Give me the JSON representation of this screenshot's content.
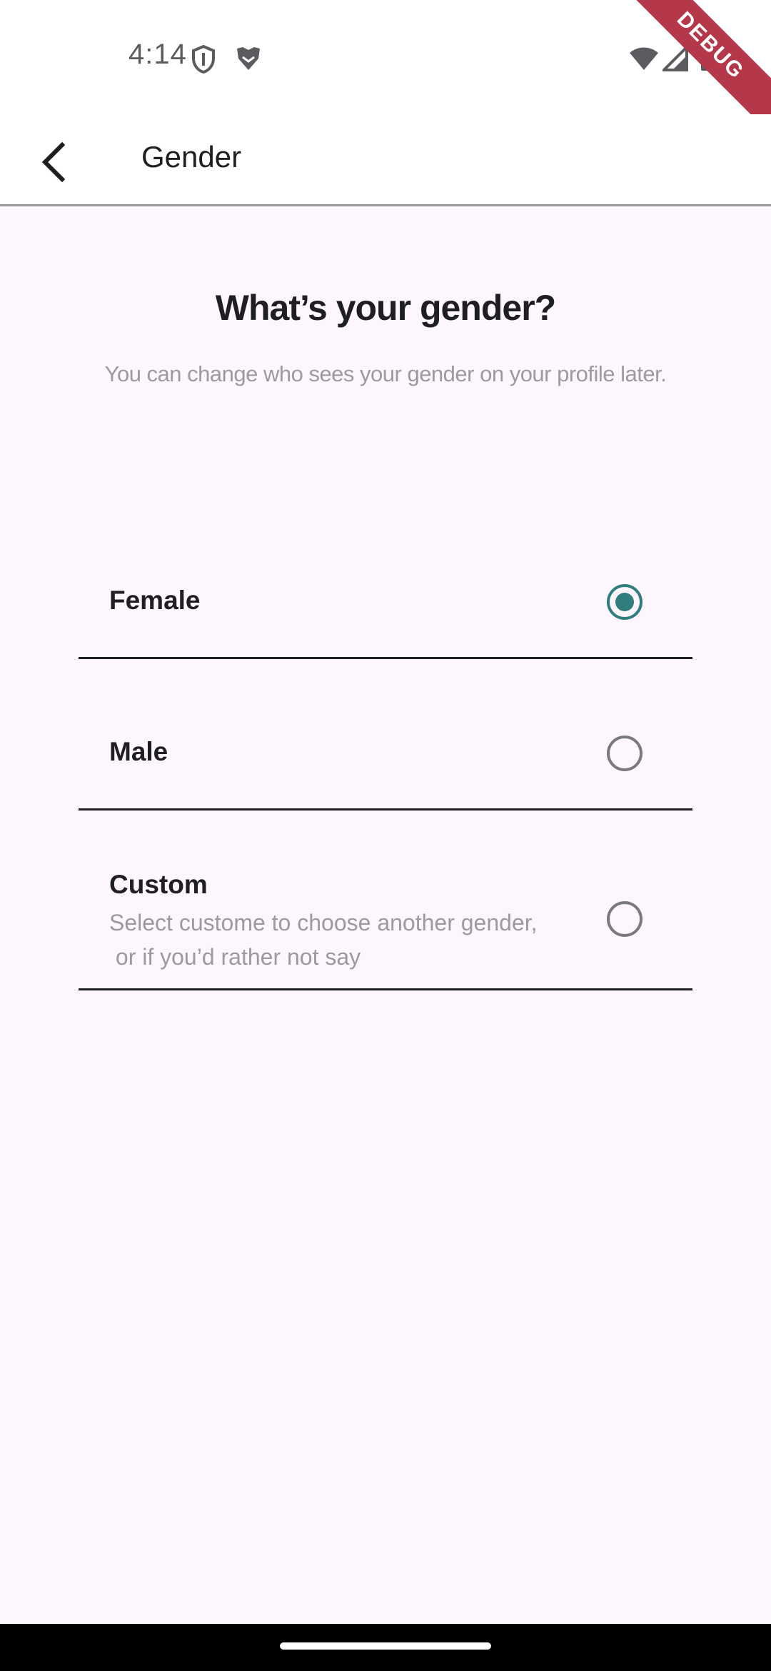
{
  "status_bar": {
    "time": "4:14",
    "icons": [
      "shield-icon",
      "brave-lion-icon",
      "wifi-icon",
      "cell-signal-icon",
      "battery-icon"
    ],
    "debug_label": "DEBUG"
  },
  "app_bar": {
    "back_icon": "back-arrow-icon",
    "title": "Gender"
  },
  "content": {
    "heading": "What’s your gender?",
    "subheading": "You can change who sees your gender on your profile later.",
    "options": [
      {
        "label": "Female",
        "description": "",
        "selected": true
      },
      {
        "label": "Male",
        "description": "",
        "selected": false
      },
      {
        "label": "Custom",
        "description": "Select custome to choose another gender,\n or if you’d rather not say",
        "selected": false
      }
    ]
  },
  "colors": {
    "accent": "#2f7d7d",
    "background": "#fdf7fd",
    "debug_banner": "#b4374a"
  }
}
